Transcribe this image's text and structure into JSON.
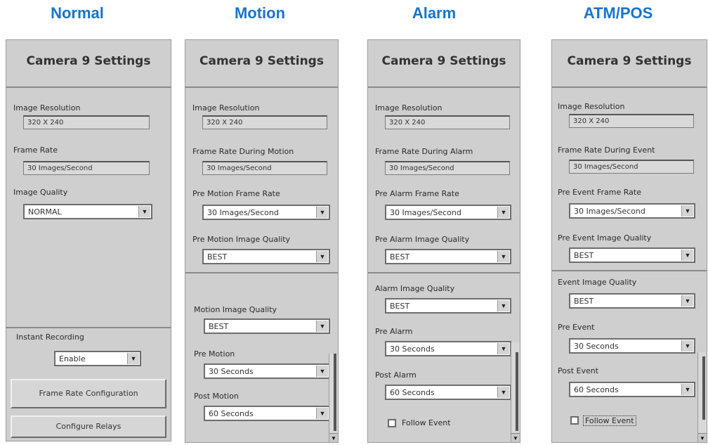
{
  "columns": {
    "normal": "Normal",
    "motion": "Motion",
    "alarm": "Alarm",
    "atm": "ATM/POS"
  },
  "panel_title": "Camera 9 Settings",
  "normal": {
    "image_resolution_label": "Image Resolution",
    "image_resolution_value": "320 X 240",
    "frame_rate_label": "Frame Rate",
    "frame_rate_value": "30 Images/Second",
    "image_quality_label": "Image Quality",
    "image_quality_value": "NORMAL",
    "instant_recording_label": "Instant Recording",
    "instant_recording_value": "Enable",
    "frame_rate_config_button": "Frame Rate Configuration",
    "configure_relays_button": "Configure Relays"
  },
  "motion": {
    "image_resolution_label": "Image Resolution",
    "image_resolution_value": "320 X 240",
    "frame_rate_label": "Frame Rate During Motion",
    "frame_rate_value": "30 Images/Second",
    "pre_frame_rate_label": "Pre Motion Frame Rate",
    "pre_frame_rate_value": "30 Images/Second",
    "pre_quality_label": "Pre Motion Image Quality",
    "pre_quality_value": "BEST",
    "quality_label": "Motion Image Quality",
    "quality_value": "BEST",
    "pre_label": "Pre Motion",
    "pre_value": "30 Seconds",
    "post_label": "Post Motion",
    "post_value": "60 Seconds"
  },
  "alarm": {
    "image_resolution_label": "Image Resolution",
    "image_resolution_value": "320 X 240",
    "frame_rate_label": "Frame Rate During Alarm",
    "frame_rate_value": "30 Images/Second",
    "pre_frame_rate_label": "Pre Alarm Frame Rate",
    "pre_frame_rate_value": "30 Images/Second",
    "pre_quality_label": "Pre Alarm Image Quality",
    "pre_quality_value": "BEST",
    "quality_label": "Alarm Image Quality",
    "quality_value": "BEST",
    "pre_label": "Pre Alarm",
    "pre_value": "30 Seconds",
    "post_label": "Post Alarm",
    "post_value": "60 Seconds",
    "follow_event_label": "Follow Event"
  },
  "atm": {
    "image_resolution_label": "Image Resolution",
    "image_resolution_value": "320 X 240",
    "frame_rate_label": "Frame Rate During Event",
    "frame_rate_value": "30 Images/Second",
    "pre_frame_rate_label": "Pre Event Frame Rate",
    "pre_frame_rate_value": "30 Images/Second",
    "pre_quality_label": "Pre Event Image Quality",
    "pre_quality_value": "BEST",
    "quality_label": "Event Image Quality",
    "quality_value": "BEST",
    "pre_label": "Pre Event",
    "pre_value": "30 Seconds",
    "post_label": "Post Event",
    "post_value": "60 Seconds",
    "follow_event_label": "Follow Event"
  },
  "icons": {
    "dropdown_arrow": "▼",
    "scroll_down": "▼"
  },
  "colors": {
    "title": "#1a73c8",
    "panel": "#cfcfcf"
  }
}
